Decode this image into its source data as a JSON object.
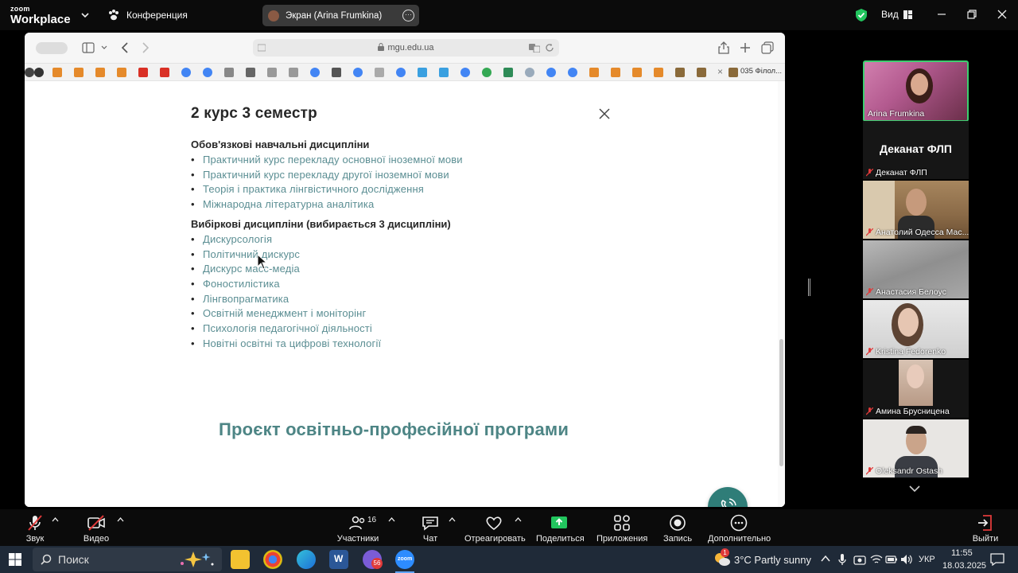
{
  "topbar": {
    "logo_top": "zoom",
    "logo_bottom": "Workplace",
    "meeting_label": "Конференция",
    "screen_share_label": "Экран (Arina Frumkina)",
    "view_label": "Вид"
  },
  "browser": {
    "url": "mgu.edu.ua",
    "bookmark_tail_label": "035 Філол..."
  },
  "page": {
    "semester_title": "2 курс 3 семестр",
    "required_title": "Обов'язкові навчальні дисципліни",
    "required_items": [
      "Практичний курс перекладу основної іноземної мови",
      "Практичний курс перекладу другої іноземної мови",
      "Теорія і практика лінгвістичного дослідження",
      "Міжнародна літературна аналітика"
    ],
    "elective_title": "Вибіркові дисципліни (вибирається 3 дисципліни)",
    "elective_items": [
      "Дискурсологія",
      "Політичний дискурс",
      "Дискурс масс-медіа",
      "Фоностилістика",
      "Лінгвопрагматика",
      "Освітній менеджмент і моніторінг",
      "Психологія педагогічної діяльності",
      "Новітні освітні та цифрові технології"
    ],
    "project_title": "Проєкт освітньо-професійної програми"
  },
  "participants": [
    {
      "name": "Arina Frumkina",
      "active": true,
      "muted": false
    },
    {
      "name": "Деканат ФЛП",
      "big_label": "Деканат ФЛП",
      "muted": true
    },
    {
      "name": "Анатолий Одесса Мас...",
      "muted": true
    },
    {
      "name": "Анастасия Белоус",
      "muted": true
    },
    {
      "name": "Kristina Fedorenko",
      "muted": true
    },
    {
      "name": "Амина Брусницена",
      "muted": true
    },
    {
      "name": "Oleksandr Ostash",
      "muted": true
    }
  ],
  "controls": {
    "audio": "Звук",
    "video": "Видео",
    "participants": "Участники",
    "participants_count": "16",
    "chat": "Чат",
    "react": "Отреагировать",
    "share": "Поделиться",
    "apps": "Приложения",
    "record": "Запись",
    "more": "Дополнительно",
    "leave": "Выйти"
  },
  "taskbar": {
    "search_placeholder": "Поиск",
    "badge_count": "56",
    "weather": "3°C  Partly sunny",
    "weather_badge": "1",
    "language": "УКР",
    "time": "11:55",
    "date": "18.03.2025"
  },
  "colors": {
    "accent_green": "#3ccf6f",
    "link_teal": "#5b8e93",
    "project_teal": "#4d8585",
    "call_button": "#2f7d78",
    "share_green": "#22c55e"
  }
}
